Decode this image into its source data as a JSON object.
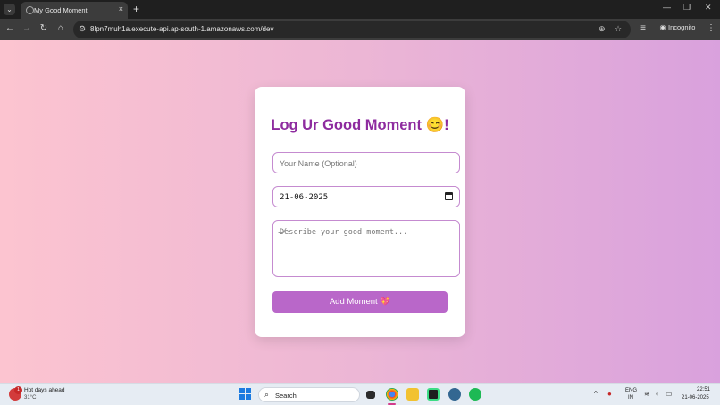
{
  "browser": {
    "tab_title": "My Good Moment",
    "tab_close": "×",
    "new_tab": "+",
    "url": "8lpn7muh1a.execute-api.ap-south-1.amazonaws.com/dev",
    "incognito_label": "Incognito",
    "window_controls": {
      "minimize": "—",
      "restore": "❐",
      "close": "✕"
    },
    "icons": [
      "back-icon",
      "forward-icon",
      "reload-icon",
      "home-icon",
      "site-info-icon",
      "zoom-icon",
      "bookmark-star-icon",
      "media-icon",
      "incognito-icon",
      "menu-icon"
    ]
  },
  "form": {
    "title": "Log Ur Good Moment 😊!",
    "name_placeholder": "Your Name (Optional)",
    "date_value": "21-06-2025",
    "description_placeholder": "Describe your good moment...",
    "submit_label": "Add Moment 💖"
  },
  "taskbar": {
    "weather_title": "Hot days ahead",
    "weather_temp": "31°C",
    "weather_badge": "1",
    "search_label": "Search",
    "language_line1": "ENG",
    "language_line2": "IN",
    "time": "22:51",
    "date": "21-06-2025"
  },
  "colors": {
    "title": "#8e2b9f",
    "button": "#b967c9",
    "field_border": "#c58bd0",
    "gradient_start": "#fcc4d0",
    "gradient_end": "#d9a1dd"
  }
}
